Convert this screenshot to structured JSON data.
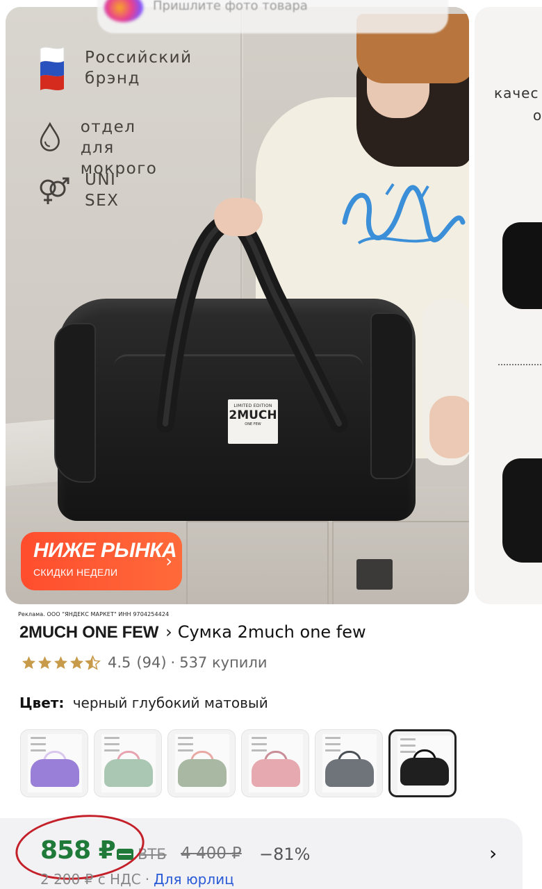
{
  "search": {
    "placeholder": "Пришлите фото товара"
  },
  "gallery": {
    "features": [
      {
        "icon": "russia-flag-icon",
        "text": "Российский\nбрэнд"
      },
      {
        "icon": "water-drop-icon",
        "text": "отдел для\nмокрого"
      },
      {
        "icon": "unisex-gender-icon",
        "text": "UNI\nSEX"
      }
    ],
    "bag_label": {
      "line1": "LIMITED EDITION",
      "line2": "2MUCH",
      "line3": "ONE FEW"
    },
    "promo": {
      "title": "НИЖЕ РЫНКА",
      "subtitle": "СКИДКИ НЕДЕЛИ",
      "arrow": "›"
    },
    "next_slide": {
      "text1": "качес",
      "text2": "о"
    }
  },
  "product": {
    "ad_note": "Реклама. ООО \"ЯНДЕКС МАРКЕТ\" ИНН 9704254424",
    "brand": "2MUCH ONE FEW",
    "title_separator": "›",
    "title": "Сумка 2much one few",
    "rating": "4.5",
    "reviews": "(94)",
    "bought": "537 купили",
    "rating_separator": "·",
    "color_label": "Цвет:",
    "color_value": "черный глубокий матовый",
    "thumbnails": [
      {
        "color": "#9a7fd8",
        "handle": "#d9c7ee",
        "selected": false
      },
      {
        "color": "#a9c7b3",
        "handle": "#e8a3b0",
        "selected": false
      },
      {
        "color": "#a9b8a2",
        "handle": "#e9a9a4",
        "selected": false
      },
      {
        "color": "#e6a9b0",
        "handle": "#c98d97",
        "selected": false
      },
      {
        "color": "#6f747a",
        "handle": "#4b5055",
        "selected": false
      },
      {
        "color": "#1f1f1f",
        "handle": "#111111",
        "selected": true
      }
    ]
  },
  "price": {
    "current": "858 ₽",
    "bank": "ВТБ",
    "old": "4 400 ₽",
    "discount": "−81%",
    "chevron": "›",
    "vat_price": "2 200 ₽ с НДС",
    "dot": "·",
    "legal_link": "Для юрлиц",
    "accent_color": "#1f7a3a",
    "highlight_color": "#c4202a"
  }
}
